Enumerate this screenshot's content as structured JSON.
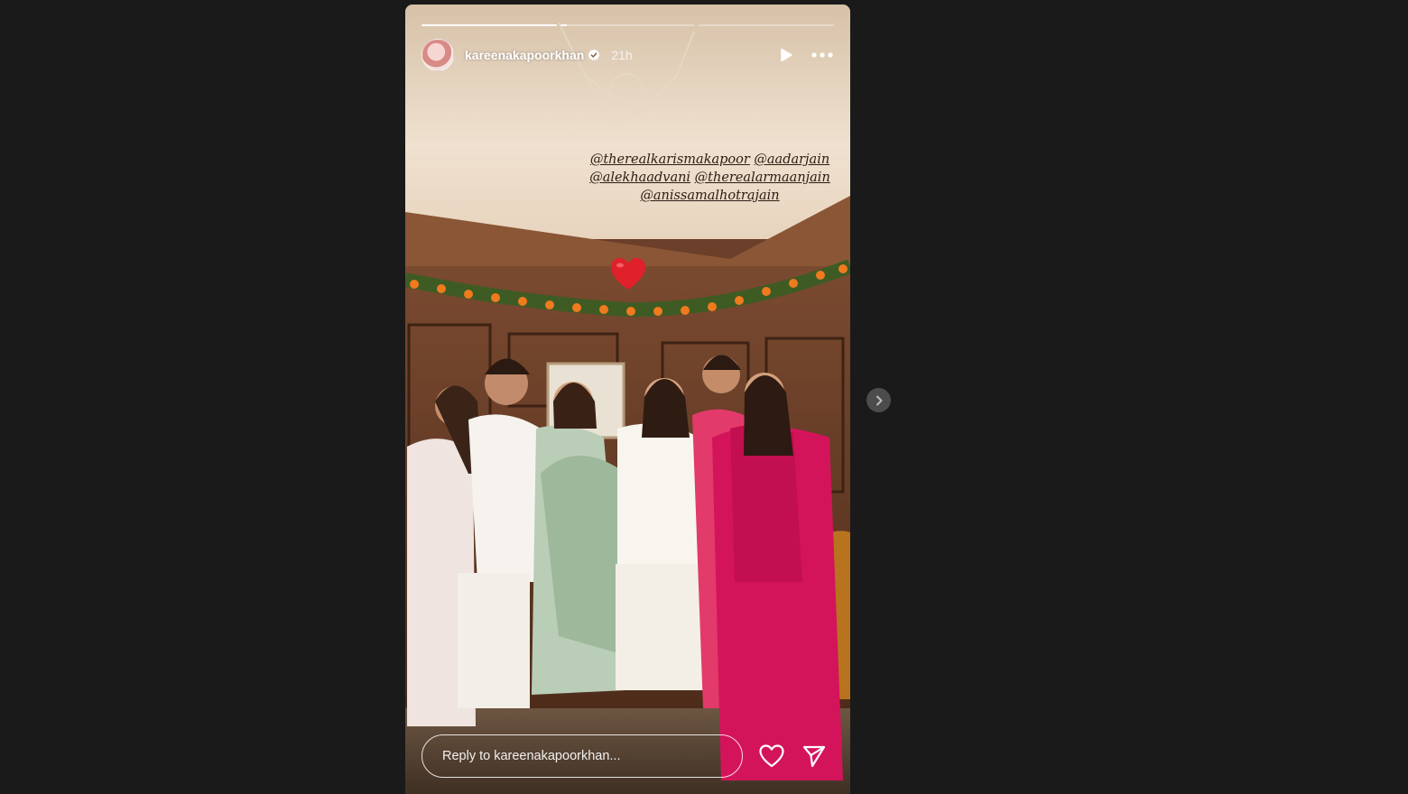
{
  "story": {
    "username": "kareenakapoorkhan",
    "time_ago": "21h",
    "progress": [
      {
        "fill": 1.0
      },
      {
        "fill": 0.05
      },
      {
        "fill": 0.0
      }
    ],
    "mentions": [
      "@therealkarismakapoor",
      "@aadarjain",
      "@alekhaadvani",
      "@therealarmaanjain",
      "@anissamalhotrajain"
    ],
    "reply_placeholder": "Reply to kareenakapoorkhan..."
  },
  "icons": {
    "verified": "verified-badge-icon",
    "play": "play-icon",
    "more": "more-options-icon",
    "like": "heart-outline-icon",
    "share": "send-icon",
    "next": "chevron-right-icon",
    "sticker": "red-heart-emoji"
  },
  "colors": {
    "background": "#1a1a1a",
    "sticker_heart": "#e0202a",
    "mention_text": "#2b1d14"
  }
}
